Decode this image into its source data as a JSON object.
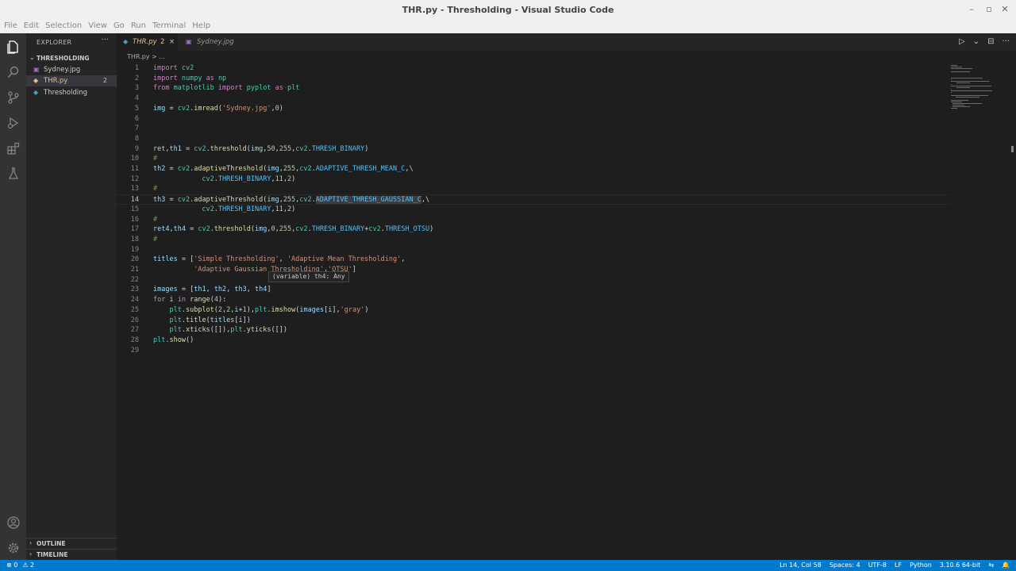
{
  "window": {
    "title": "THR.py - Thresholding - Visual Studio Code",
    "min_glyph": "–",
    "max_glyph": "▫",
    "close_glyph": "✕"
  },
  "menu": [
    "File",
    "Edit",
    "Selection",
    "View",
    "Go",
    "Run",
    "Terminal",
    "Help"
  ],
  "activity_icons": [
    "files-icon",
    "search-icon",
    "source-control-icon",
    "run-debug-icon",
    "extensions-icon",
    "testing-icon",
    "account-icon",
    "settings-gear-icon"
  ],
  "sidebar": {
    "title": "EXPLORER",
    "more": "···",
    "folder": "THRESHOLDING",
    "files": [
      {
        "name": "Sydney.jpg",
        "icon": "image-file-icon",
        "glyph": "▣",
        "color": "#a074c4",
        "badge": ""
      },
      {
        "name": "THR.py",
        "icon": "python-file-icon",
        "glyph": "◆",
        "color": "#e2c08d",
        "badge": "2"
      },
      {
        "name": "Thresholding",
        "icon": "folder-file-icon",
        "glyph": "◆",
        "color": "#519aba",
        "badge": ""
      }
    ],
    "outline": "OUTLINE",
    "timeline": "TIMELINE"
  },
  "tabs": [
    {
      "label": "THR.py",
      "badge": "2",
      "close": "×",
      "active": true,
      "color": "#e2c08d"
    },
    {
      "label": "Sydney.jpg",
      "badge": "",
      "close": "",
      "active": false,
      "color": "#a074c4"
    }
  ],
  "tab_actions": {
    "run": "▷",
    "split": "⊟",
    "more": "···",
    "chevron": "⌄"
  },
  "breadcrumb": "THR.py > ...",
  "editor": {
    "current_line": 14,
    "lines": [
      "import cv2",
      "import numpy as np",
      "from matplotlib import pyplot as plt",
      "",
      "img = cv2.imread('Sydney.jpg',0)",
      "",
      "",
      "",
      "ret,th1 = cv2.threshold(img,50,255,cv2.THRESH_BINARY)",
      "#",
      "th2 = cv2.adaptiveThreshold(img,255,cv2.ADAPTIVE_THRESH_MEAN_C,\\",
      "            cv2.THRESH_BINARY,11,2)",
      "#",
      "th3 = cv2.adaptiveThreshold(img,255,cv2.ADAPTIVE_THRESH_GAUSSIAN_C,\\",
      "            cv2.THRESH_BINARY,11,2)",
      "#",
      "ret4,th4 = cv2.threshold(img,0,255,cv2.THRESH_BINARY+cv2.THRESH_OTSU)",
      "#",
      "",
      "titles = ['Simple Thresholding', 'Adaptive Mean Thresholding',",
      "          'Adaptive Gaussian Thresholding','OTSU']",
      "",
      "images = [th1, th2, th3, th4]",
      "for i in range(4):",
      "    plt.subplot(2,2,i+1),plt.imshow(images[i],'gray')",
      "    plt.title(titles[i])",
      "    plt.xticks([]),plt.yticks([])",
      "plt.show()",
      ""
    ],
    "hover": "(variable) th4: Any"
  },
  "status": {
    "errors": "⊗ 0",
    "warnings": "⚠ 2",
    "position": "Ln 14, Col 58",
    "spaces": "Spaces: 4",
    "encoding": "UTF-8",
    "eol": "LF",
    "language": "Python",
    "interpreter": "3.10.6 64-bit",
    "feedback": "⇆",
    "notifications": "🔔"
  }
}
